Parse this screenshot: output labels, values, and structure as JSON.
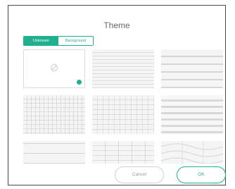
{
  "dialog": {
    "title": "Theme",
    "tabs": [
      {
        "label": "Unknown",
        "active": true
      },
      {
        "label": "Background",
        "active": false
      }
    ],
    "tiles": [
      {
        "name": "blank",
        "selected": true
      },
      {
        "name": "lined"
      },
      {
        "name": "wide-lined"
      },
      {
        "name": "grid-fine"
      },
      {
        "name": "grid-medium"
      },
      {
        "name": "striped"
      },
      {
        "name": "stave"
      },
      {
        "name": "staff-grid"
      },
      {
        "name": "curves"
      }
    ],
    "buttons": {
      "cancel_label": "Cancel",
      "ok_label": "OK"
    }
  },
  "colors": {
    "accent": "#20b08d",
    "border": "#4a4a4a",
    "title_text": "#666666"
  },
  "icons": {
    "placeholder": "image-placeholder-icon",
    "selected": "selected-dot-icon"
  }
}
